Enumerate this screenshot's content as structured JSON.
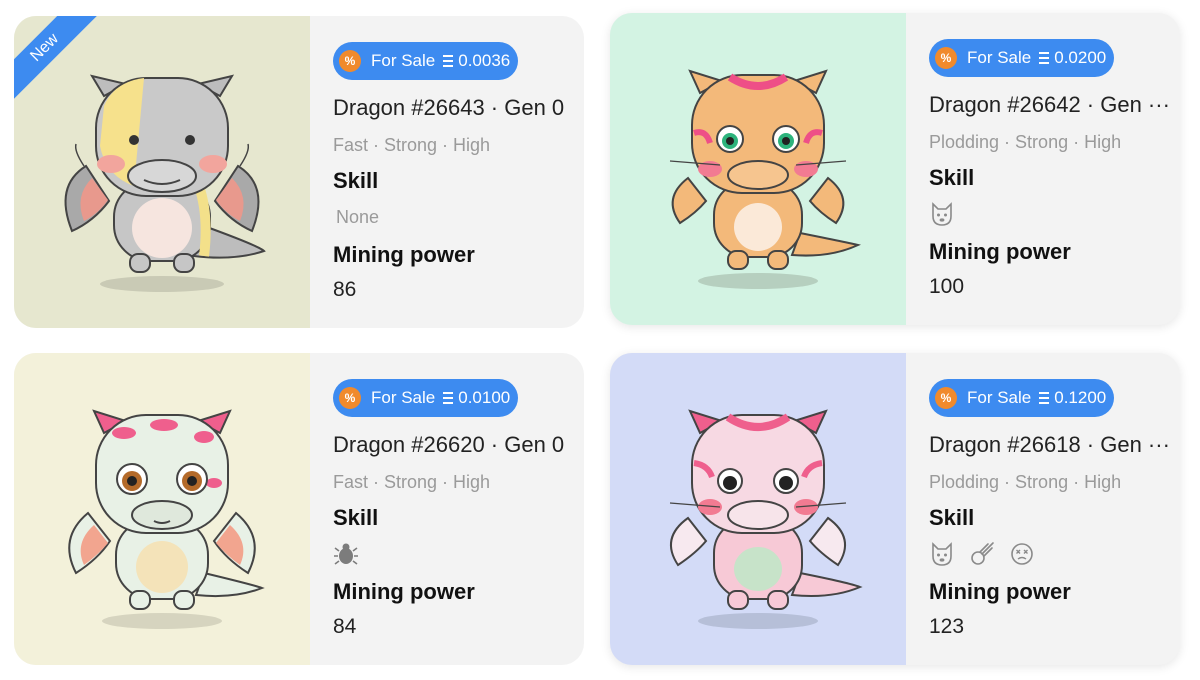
{
  "colors": {
    "accent": "#3d8bf0",
    "coin": "#f08a2c",
    "card_bg": "#f3f3f3",
    "art_bgs": [
      "#e6e7cf",
      "#d3f3e3",
      "#f3f1da",
      "#d3dbf7"
    ]
  },
  "cards": [
    {
      "ribbon": "New",
      "sale_label": "For Sale",
      "price": "0.0036",
      "title": "Dragon #26643 · Gen 0",
      "traits": "Fast · Strong · High",
      "skill_label": "Skill",
      "skill_text": "None",
      "skill_icons": [],
      "power_label": "Mining power",
      "power": "86"
    },
    {
      "sale_label": "For Sale",
      "price": "0.0200",
      "title": "Dragon #26642 · Gen ···",
      "traits": "Plodding · Strong · High",
      "skill_label": "Skill",
      "skill_icons": [
        "dog-face-icon"
      ],
      "power_label": "Mining power",
      "power": "100"
    },
    {
      "sale_label": "For Sale",
      "price": "0.0100",
      "title": "Dragon #26620 · Gen 0",
      "traits": "Fast · Strong · High",
      "skill_label": "Skill",
      "skill_icons": [
        "beetle-icon"
      ],
      "power_label": "Mining power",
      "power": "84"
    },
    {
      "sale_label": "For Sale",
      "price": "0.1200",
      "title": "Dragon #26618 · Gen ···",
      "traits": "Plodding · Strong · High",
      "skill_label": "Skill",
      "skill_icons": [
        "dog-face-icon",
        "comet-icon",
        "dizzy-face-icon"
      ],
      "power_label": "Mining power",
      "power": "123"
    }
  ]
}
